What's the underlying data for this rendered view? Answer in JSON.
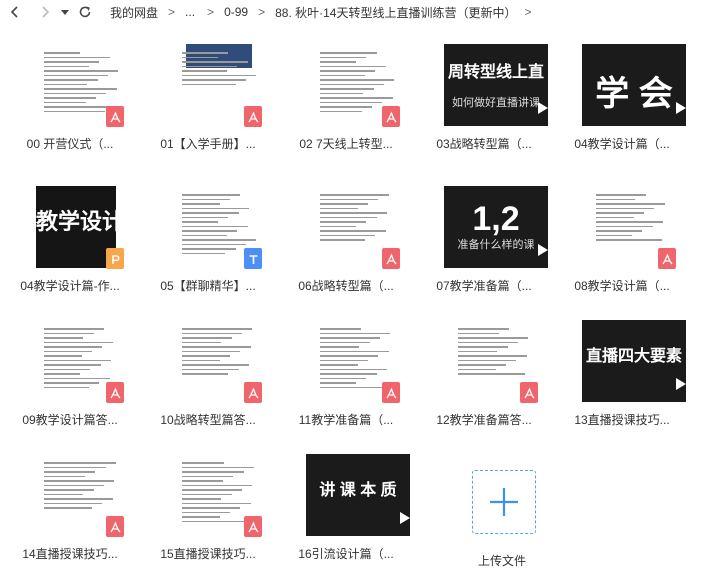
{
  "breadcrumb": {
    "items": [
      "我的网盘",
      "...",
      "0-99",
      "88. 秋叶·14天转型线上直播训练营（更新中）"
    ],
    "separator": ">"
  },
  "colors": {
    "pdf_badge": "#f0656c",
    "ppt_badge": "#f7a64a",
    "txt_badge": "#4e8ef7",
    "upload_accent": "#5aa0f0"
  },
  "files": [
    {
      "name": "00  开营仪式（...",
      "kind": "doc",
      "badge": "pdf",
      "icon": "pdf-file-icon"
    },
    {
      "name": "01【入学手册】...",
      "kind": "doc",
      "badge": "pdf",
      "icon": "pdf-file-icon"
    },
    {
      "name": "02 7天线上转型...",
      "kind": "doc",
      "badge": "pdf",
      "icon": "pdf-file-icon"
    },
    {
      "name": "03战略转型篇（...",
      "kind": "video",
      "thumb_text": "周转型线上直",
      "thumb_sub": "如何做好直播讲课",
      "icon": "video-file-icon"
    },
    {
      "name": "04教学设计篇（...",
      "kind": "video",
      "thumb_text": "学 会",
      "icon": "video-file-icon"
    },
    {
      "name": "04教学设计篇-作...",
      "kind": "doc",
      "badge": "ppt",
      "thumb_text": "教学设计篇",
      "icon": "ppt-file-icon"
    },
    {
      "name": "05【群聊精华】...",
      "kind": "doc",
      "badge": "txt",
      "icon": "txt-file-icon"
    },
    {
      "name": "06战略转型篇（...",
      "kind": "doc",
      "badge": "pdf",
      "icon": "pdf-file-icon"
    },
    {
      "name": "07教学准备篇（...",
      "kind": "video",
      "thumb_text": "1,2",
      "thumb_sub": "准备什么样的课",
      "icon": "video-file-icon"
    },
    {
      "name": "08教学设计篇（...",
      "kind": "doc",
      "badge": "pdf",
      "icon": "pdf-file-icon"
    },
    {
      "name": "09教学设计篇答...",
      "kind": "doc",
      "badge": "pdf",
      "icon": "pdf-file-icon"
    },
    {
      "name": "10战略转型篇答...",
      "kind": "doc",
      "badge": "pdf",
      "icon": "pdf-file-icon"
    },
    {
      "name": "11教学准备篇（...",
      "kind": "doc",
      "badge": "pdf",
      "icon": "pdf-file-icon"
    },
    {
      "name": "12教学准备篇答...",
      "kind": "doc",
      "badge": "pdf",
      "icon": "pdf-file-icon"
    },
    {
      "name": "13直播授课技巧...",
      "kind": "video",
      "thumb_text": "直播四大要素",
      "icon": "video-file-icon"
    },
    {
      "name": "14直播授课技巧...",
      "kind": "doc",
      "badge": "pdf",
      "icon": "pdf-file-icon"
    },
    {
      "name": "15直播授课技巧...",
      "kind": "doc",
      "badge": "pdf",
      "icon": "pdf-file-icon"
    },
    {
      "name": "16引流设计篇（...",
      "kind": "video",
      "thumb_text": "讲 课 本 质",
      "icon": "video-file-icon"
    }
  ],
  "upload": {
    "label": "上传文件"
  }
}
